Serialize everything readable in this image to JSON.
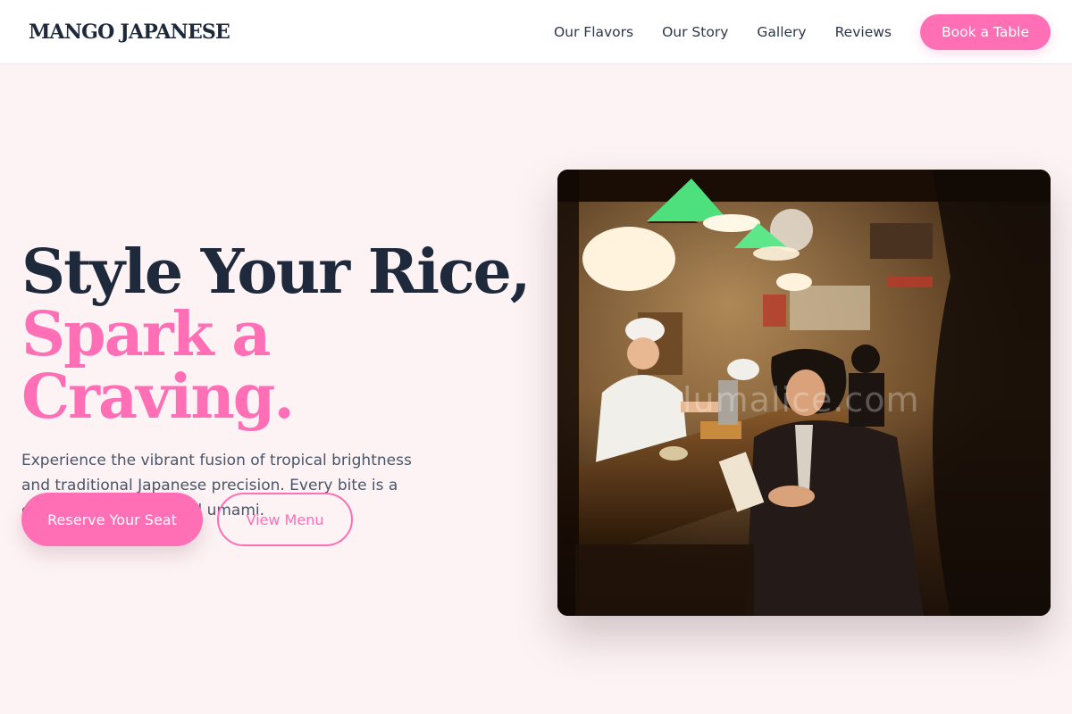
{
  "header": {
    "logo": "MANGO JAPANESE",
    "nav": [
      "Our Flavors",
      "Our Story",
      "Gallery",
      "Reviews"
    ],
    "cta": "Book a Table"
  },
  "hero": {
    "headline_line1": "Style Your Rice,",
    "headline_line2": "Spark a Craving.",
    "description": "Experience the vibrant fusion of tropical brightness and traditional Japanese precision. Every bite is a celebration of color and umami.",
    "primary_button": "Reserve Your Seat",
    "secondary_button": "View Menu",
    "image_watermark": "lumalice.com"
  },
  "colors": {
    "accent": "#ff6fb5",
    "heading": "#1e2a3b",
    "body_text": "#4a5568",
    "page_bg": "#fdf3f4"
  }
}
